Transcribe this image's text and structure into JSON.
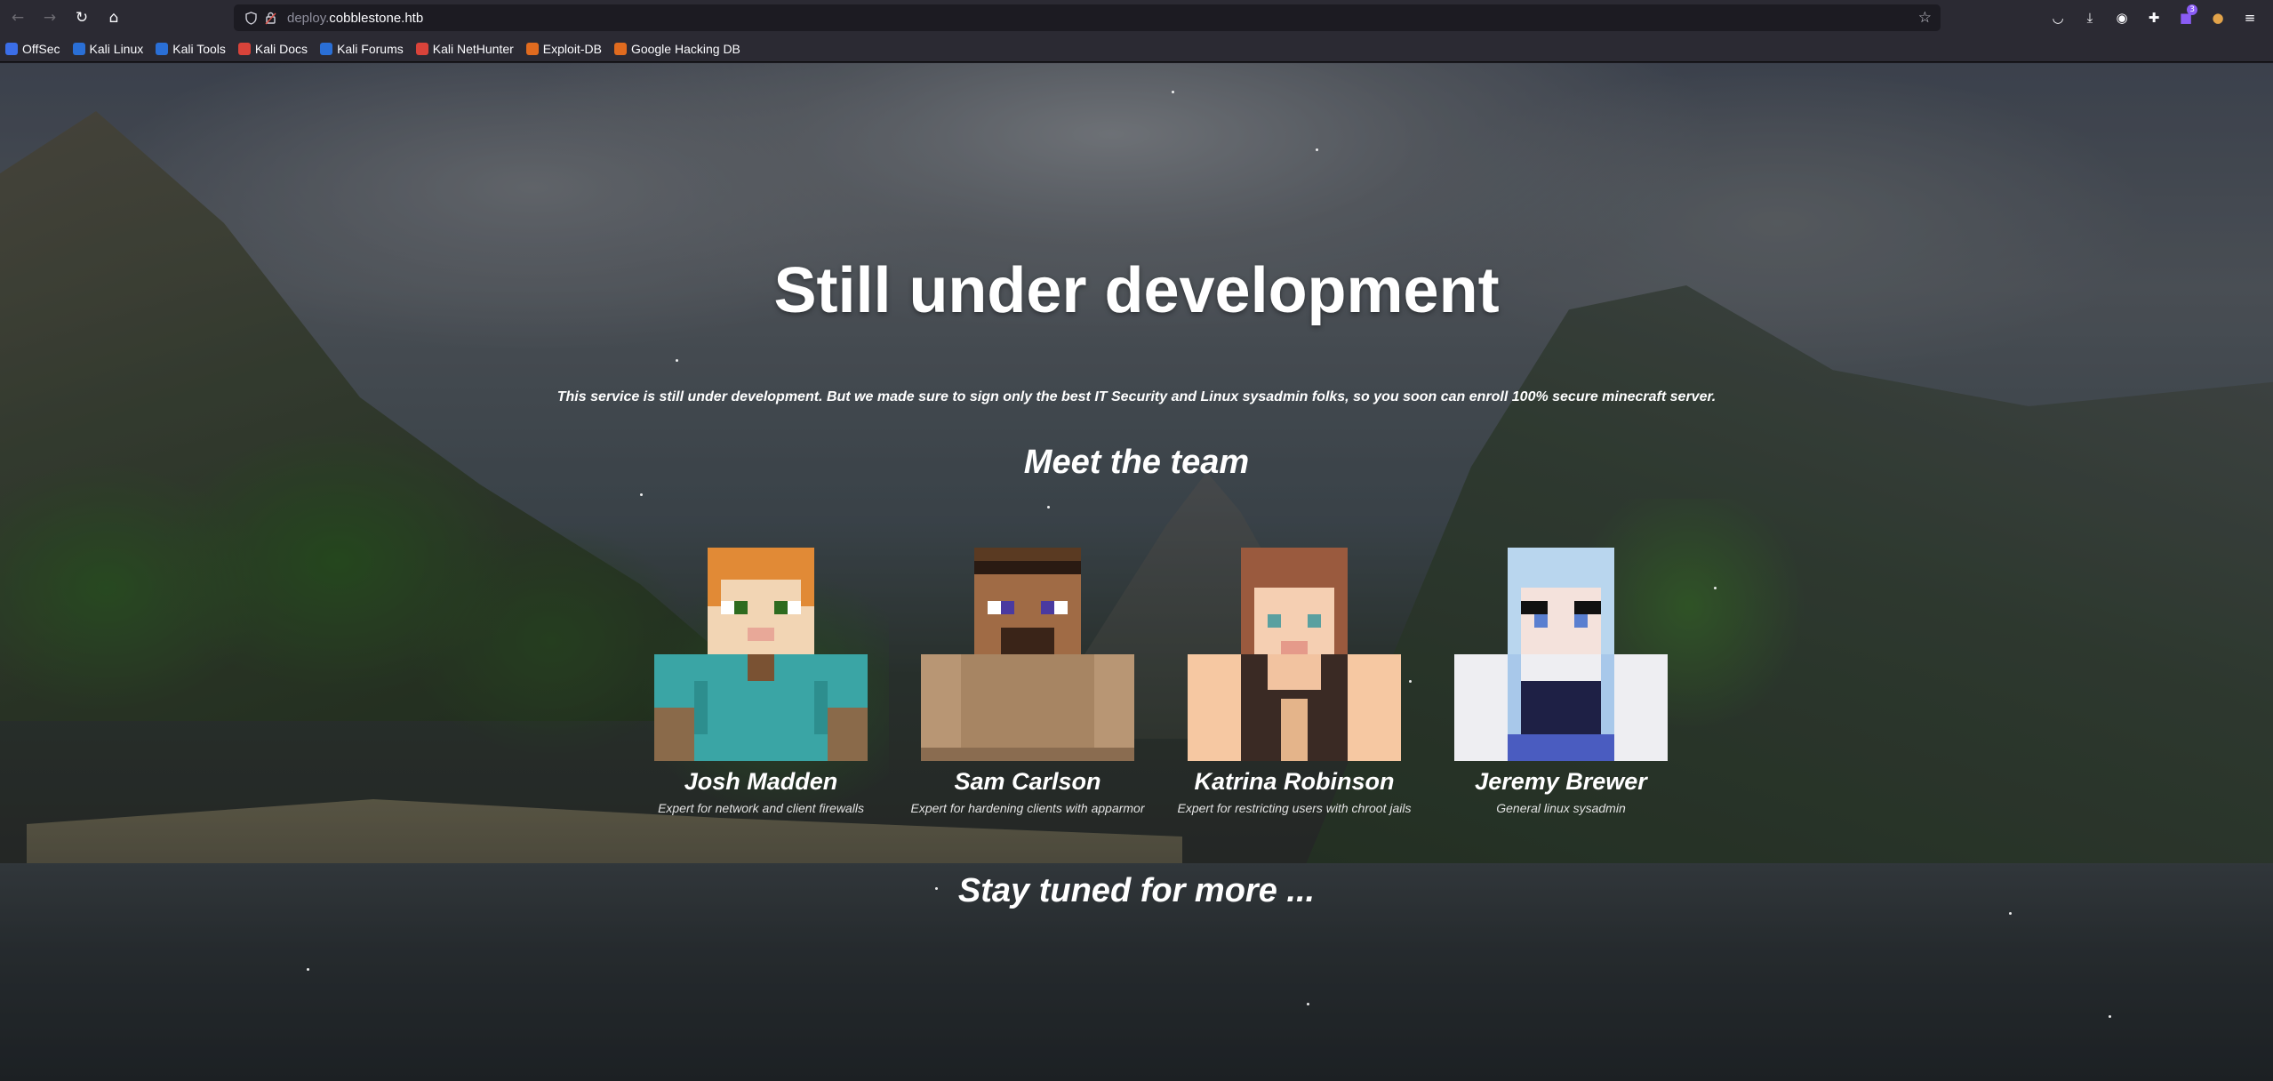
{
  "browser": {
    "url_prefix": "deploy.",
    "url_domain": "cobblestone.htb",
    "nav": {
      "back_icon": "arrow-left-icon",
      "forward_icon": "arrow-right-icon",
      "reload_icon": "reload-icon",
      "home_icon": "home-icon"
    },
    "extension_badge": "3",
    "bookmarks": [
      {
        "label": "OffSec",
        "color": "#3b6ee8"
      },
      {
        "label": "Kali Linux",
        "color": "#2a6fd6"
      },
      {
        "label": "Kali Tools",
        "color": "#2a6fd6"
      },
      {
        "label": "Kali Docs",
        "color": "#d9433a"
      },
      {
        "label": "Kali Forums",
        "color": "#2a6fd6"
      },
      {
        "label": "Kali NetHunter",
        "color": "#d9433a"
      },
      {
        "label": "Exploit-DB",
        "color": "#e06b1f"
      },
      {
        "label": "Google Hacking DB",
        "color": "#e06b1f"
      }
    ]
  },
  "page": {
    "title": "Still under development",
    "subtitle": "This service is still under development. But we made sure to sign only the best IT Security and Linux sysadmin folks, so you soon can enroll 100% secure minecraft server.",
    "team_heading": "Meet the team",
    "team": [
      {
        "name": "Josh Madden",
        "role": "Expert for network and client firewalls"
      },
      {
        "name": "Sam Carlson",
        "role": "Expert for hardening clients with apparmor"
      },
      {
        "name": "Katrina Robinson",
        "role": "Expert for restricting users with chroot jails"
      },
      {
        "name": "Jeremy Brewer",
        "role": "General linux sysadmin"
      }
    ],
    "footer": "Stay tuned for more ..."
  }
}
